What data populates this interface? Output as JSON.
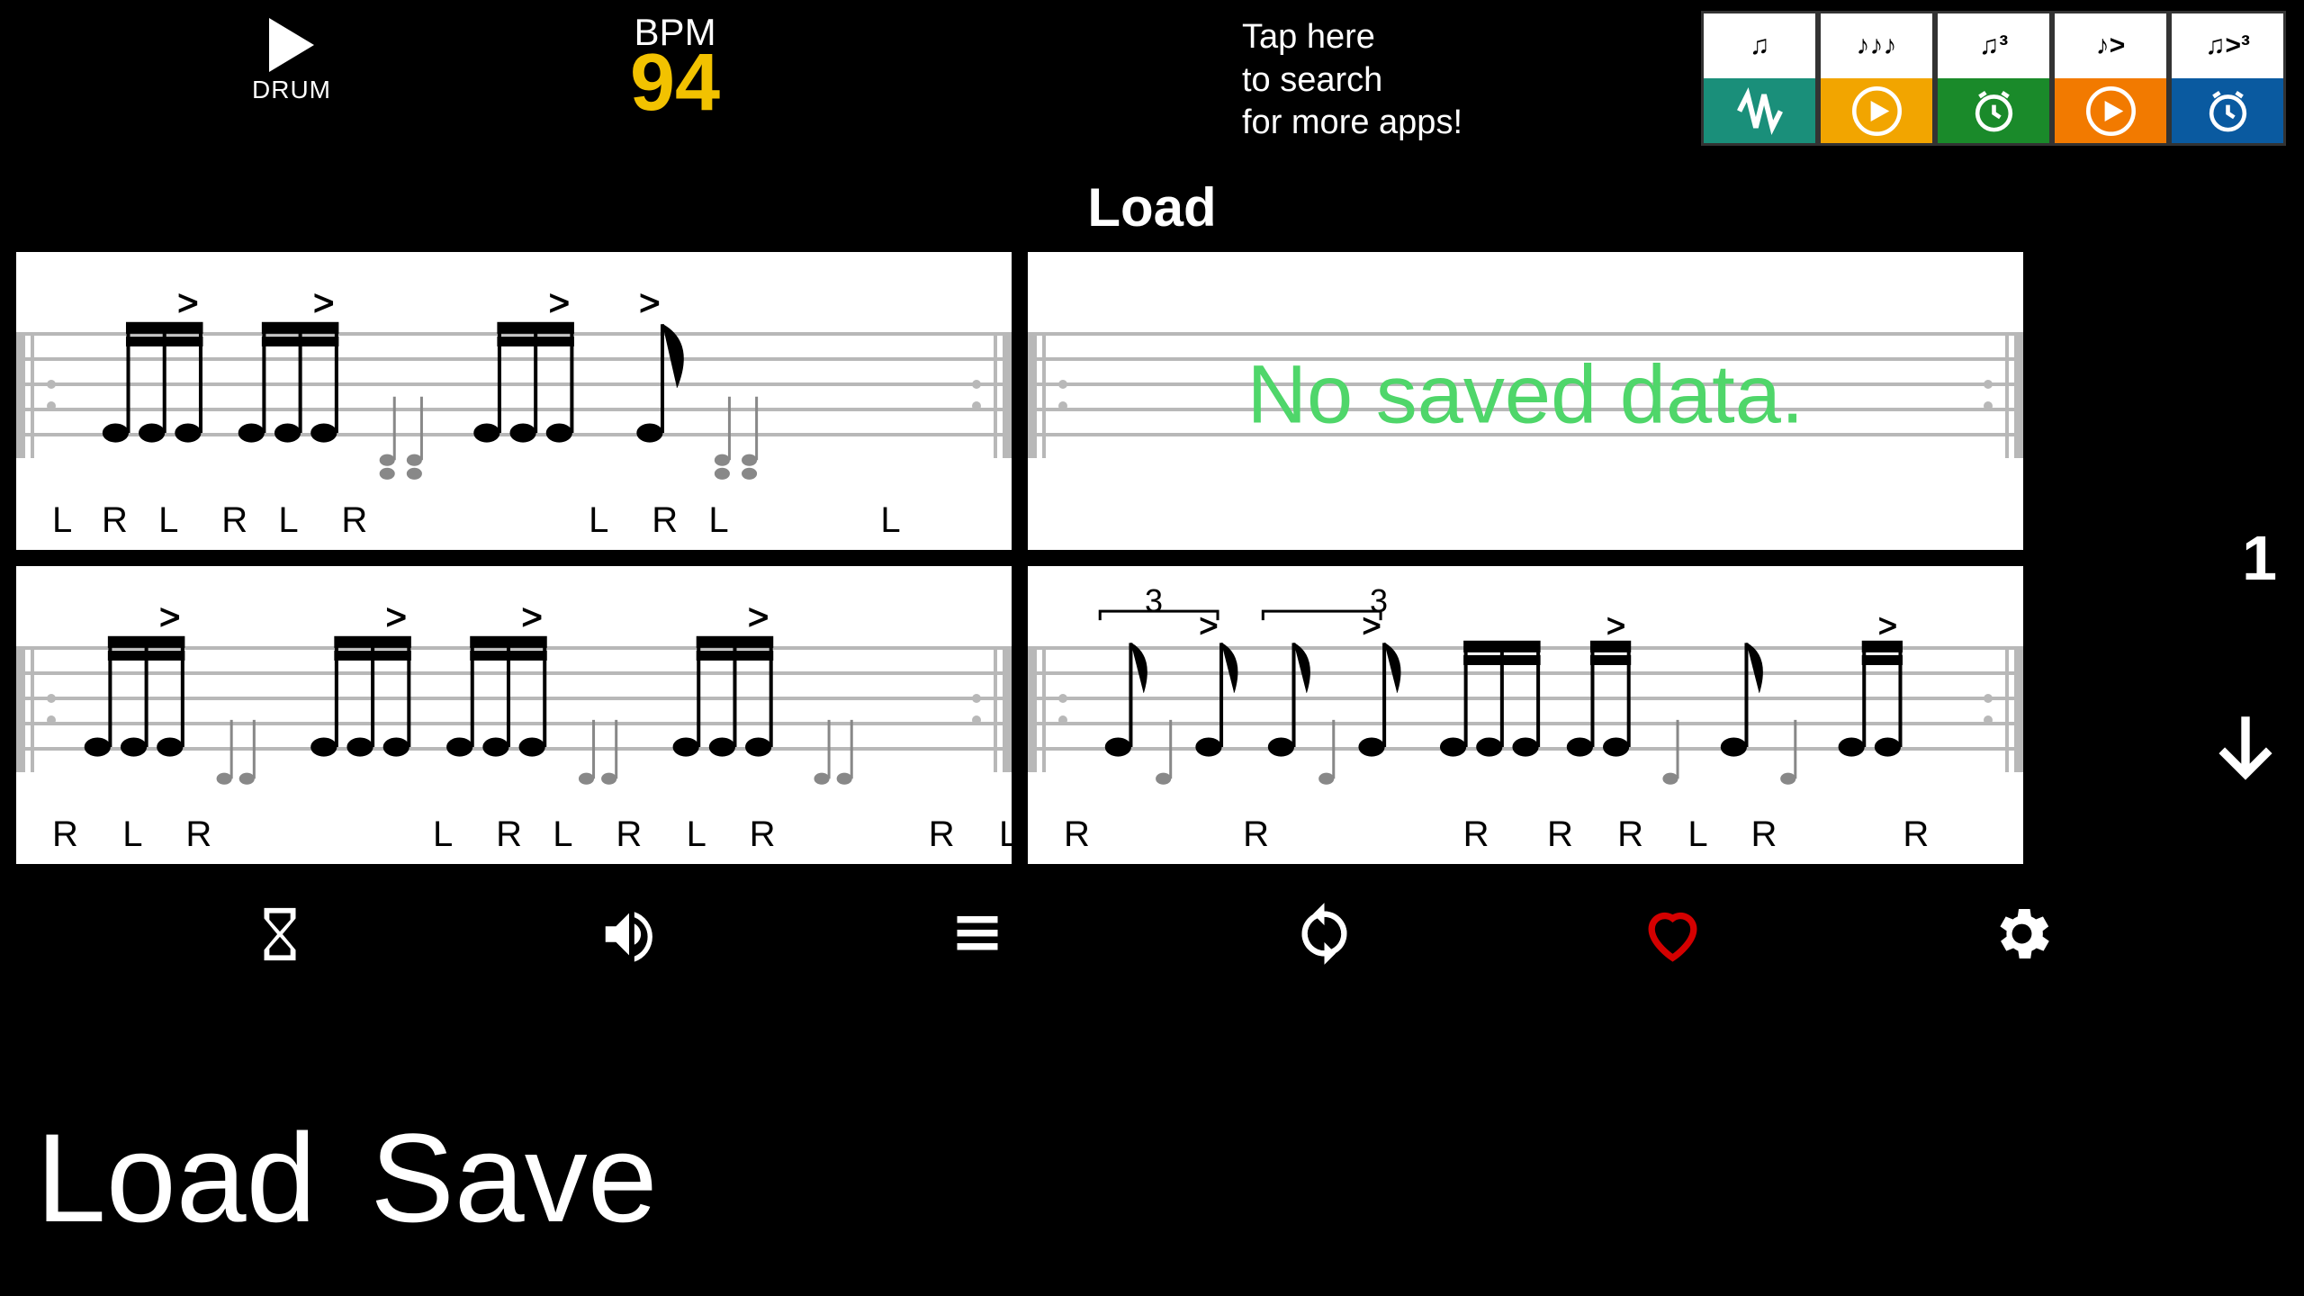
{
  "header": {
    "play_label": "DRUM",
    "bpm_label": "BPM",
    "bpm_value": "94",
    "search_prompt_l1": "Tap here",
    "search_prompt_l2": "to search",
    "search_prompt_l3": "for more apps!",
    "app_icons": [
      {
        "glyph": "♫",
        "bg": "#1a8f7a"
      },
      {
        "glyph": "♪♪♪",
        "bg": "#f2a500"
      },
      {
        "glyph": "♫³",
        "bg": "#1a8a2a"
      },
      {
        "glyph": "♪>",
        "bg": "#f27a00"
      },
      {
        "glyph": "♫>³",
        "bg": "#0a5aa0"
      }
    ]
  },
  "section_title": "Load",
  "page_number": "1",
  "cells": {
    "tl_sticking": "L  R  L   R  L   R                L   R  L           L",
    "tr_text": "No saved data.",
    "bl_sticking": "R   L   R                L   R  L   R   L   R           R   L   R",
    "br_sticking": "R           R              R    R   R   L   R         R           R   L",
    "br_triplets": [
      "3",
      "3"
    ]
  },
  "bottom": {
    "load_label": "Load",
    "save_label": "Save"
  },
  "colors": {
    "accent": "#f2c200",
    "heart": "#d40000",
    "success": "#4fd66a"
  }
}
